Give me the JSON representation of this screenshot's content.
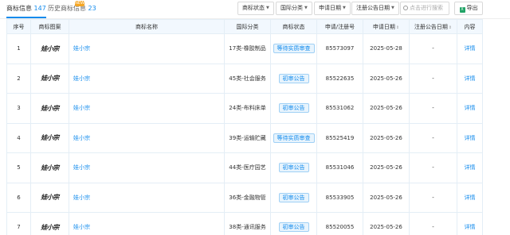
{
  "tabs": [
    {
      "label": "商标信息",
      "count": "147",
      "active": true
    },
    {
      "label": "历史商标信息",
      "count": "23",
      "active": false,
      "badge": "NEW"
    }
  ],
  "filters": [
    {
      "label": "商标状态"
    },
    {
      "label": "国际分类"
    },
    {
      "label": "申请日期"
    },
    {
      "label": "注册公告日期"
    }
  ],
  "search": {
    "placeholder": "点击进行搜索"
  },
  "export": {
    "label": "导出",
    "icon": "excel-icon"
  },
  "table": {
    "headers": {
      "index": "序号",
      "image": "商标图案",
      "name": "商标名称",
      "class": "国际分类",
      "status": "商标状态",
      "regno": "申请/注册号",
      "appdate": "申请日期",
      "regdate": "注册公告日期",
      "content": "内容"
    },
    "rows": [
      {
        "index": "1",
        "logo": "娃小宗",
        "name": "娃小宗",
        "class": "17类-橡胶制品",
        "status": "等待实质审查",
        "regno": "85573097",
        "appdate": "2025-05-28",
        "regdate": "-",
        "detail": "详情"
      },
      {
        "index": "2",
        "logo": "娃小宗",
        "name": "娃小宗",
        "class": "45类-社会服务",
        "status": "初审公告",
        "regno": "85522635",
        "appdate": "2025-05-26",
        "regdate": "-",
        "detail": "详情"
      },
      {
        "index": "3",
        "logo": "娃小宗",
        "name": "娃小宗",
        "class": "24类-布料床单",
        "status": "初审公告",
        "regno": "85531062",
        "appdate": "2025-05-26",
        "regdate": "-",
        "detail": "详情"
      },
      {
        "index": "4",
        "logo": "娃小宗",
        "name": "娃小宗",
        "class": "39类-运输贮藏",
        "status": "等待实质审查",
        "regno": "85525419",
        "appdate": "2025-05-26",
        "regdate": "-",
        "detail": "详情"
      },
      {
        "index": "5",
        "logo": "娃小宗",
        "name": "娃小宗",
        "class": "44类-医疗园艺",
        "status": "初审公告",
        "regno": "85531046",
        "appdate": "2025-05-26",
        "regdate": "-",
        "detail": "详情"
      },
      {
        "index": "6",
        "logo": "娃小宗",
        "name": "娃小宗",
        "class": "36类-金融物管",
        "status": "初审公告",
        "regno": "85533905",
        "appdate": "2025-05-26",
        "regdate": "-",
        "detail": "详情"
      },
      {
        "index": "7",
        "logo": "娃小宗",
        "name": "娃小宗",
        "class": "38类-通讯服务",
        "status": "初审公告",
        "regno": "85520055",
        "appdate": "2025-05-26",
        "regdate": "-",
        "detail": "详情"
      }
    ]
  }
}
